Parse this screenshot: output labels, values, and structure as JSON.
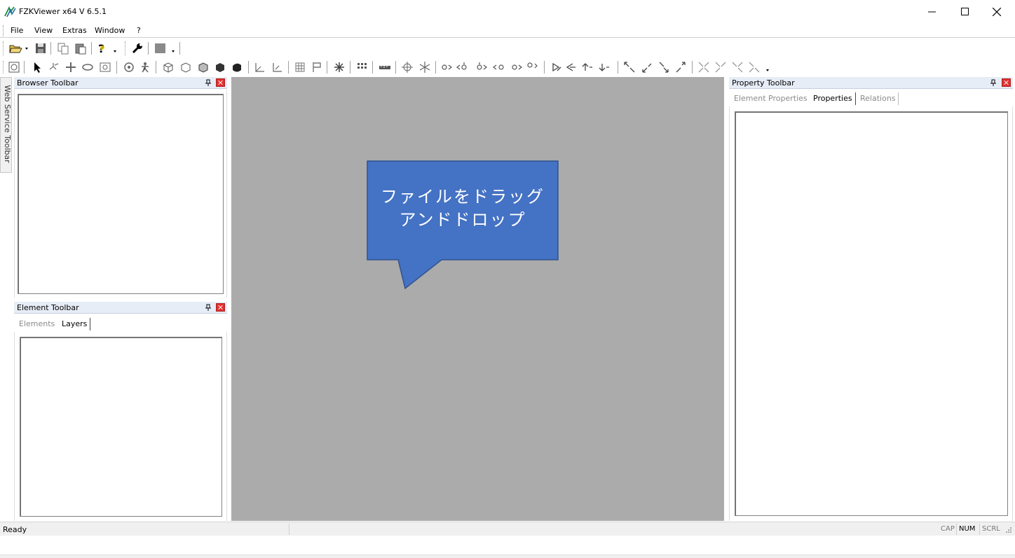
{
  "window": {
    "title": "FZKViewer x64 V 6.5.1",
    "icon": "fzk-logo-icon"
  },
  "menu": {
    "items": [
      "File",
      "View",
      "Extras",
      "Window",
      "?"
    ]
  },
  "side_dock": {
    "label": "Web Service Toolbar"
  },
  "browser_panel": {
    "title": "Browser Toolbar"
  },
  "element_panel": {
    "title": "Element Toolbar",
    "tabs": [
      "Elements",
      "Layers"
    ],
    "active_tab": "Layers"
  },
  "property_panel": {
    "title": "Property Toolbar",
    "tabs": [
      "Element Properties",
      "Properties",
      "Relations"
    ],
    "active_tab": "Properties"
  },
  "viewport": {
    "callout_line1": "ファイルをドラッグ",
    "callout_line2": "アンドドロップ",
    "callout_color": "#4472c4",
    "callout_border": "#2f528f",
    "background": "#ababab"
  },
  "status": {
    "text": "Ready",
    "indicators": [
      "CAP",
      "NUM",
      "SCRL"
    ],
    "active_indicator": "NUM"
  },
  "colors": {
    "panel_header": "#e7edf7",
    "close_red": "#e0312f",
    "app_icon_green": "#1e8c3a"
  }
}
